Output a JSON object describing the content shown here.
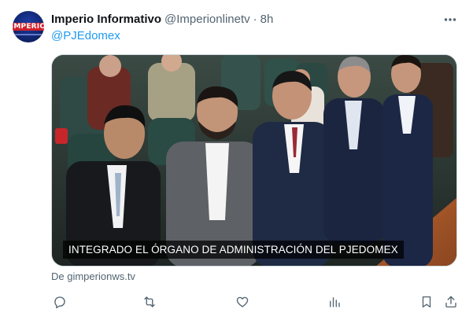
{
  "tweet": {
    "author_name": "Imperio Informativo",
    "author_handle": "@Imperionlinetv",
    "separator": "·",
    "time": "8h",
    "avatar_text": "IMPERIO",
    "mention": "@PJEdomex",
    "media_caption": "INTEGRADO EL ÓRGANO DE ADMINISTRACIÓN DEL PJEDOMEX",
    "source": "De gimperionws.tv"
  },
  "icons": {
    "more": "more-dots-icon",
    "reply": "reply-icon",
    "retweet": "retweet-icon",
    "like": "heart-icon",
    "views": "views-icon",
    "bookmark": "bookmark-icon",
    "share": "share-icon"
  },
  "colors": {
    "accent": "#1d9bf0",
    "muted": "#536471",
    "text": "#0f1419"
  }
}
